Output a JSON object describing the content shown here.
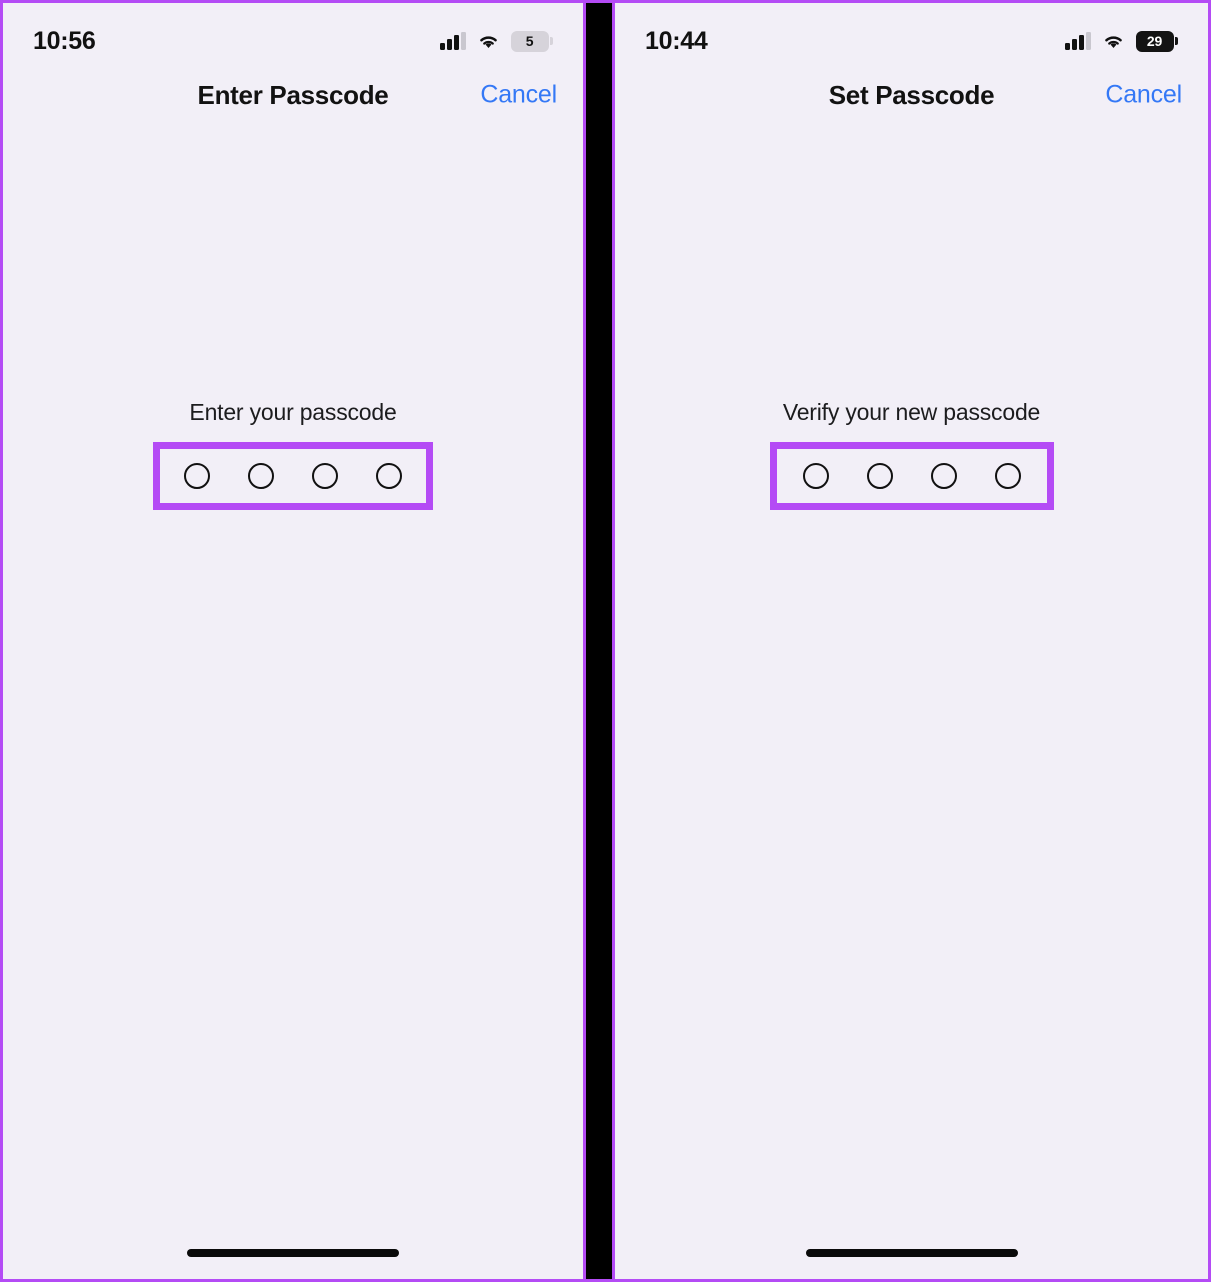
{
  "figure": {
    "accent_highlight_color": "#b44bf5",
    "background_color": "#f2eff7",
    "divider_color": "#000000",
    "link_color": "#3478f6"
  },
  "panels": [
    {
      "id": "left",
      "status_bar": {
        "time": "10:56",
        "cellular_icon": "cellular-bars-icon",
        "wifi_icon": "wifi-icon",
        "battery_icon": "battery-icon",
        "battery_level": "5",
        "battery_style": "low-power"
      },
      "nav": {
        "title": "Enter Passcode",
        "action_label": "Cancel"
      },
      "passcode": {
        "prompt": "Enter your passcode",
        "dot_count": 4,
        "dots_filled": 0,
        "highlighted": true
      },
      "home_indicator": "home-indicator"
    },
    {
      "id": "right",
      "status_bar": {
        "time": "10:44",
        "cellular_icon": "cellular-bars-icon",
        "wifi_icon": "wifi-icon",
        "battery_icon": "battery-icon",
        "battery_level": "29",
        "battery_style": "dark"
      },
      "nav": {
        "title": "Set Passcode",
        "action_label": "Cancel"
      },
      "passcode": {
        "prompt": "Verify your new passcode",
        "dot_count": 4,
        "dots_filled": 0,
        "highlighted": true
      },
      "home_indicator": "home-indicator"
    }
  ]
}
